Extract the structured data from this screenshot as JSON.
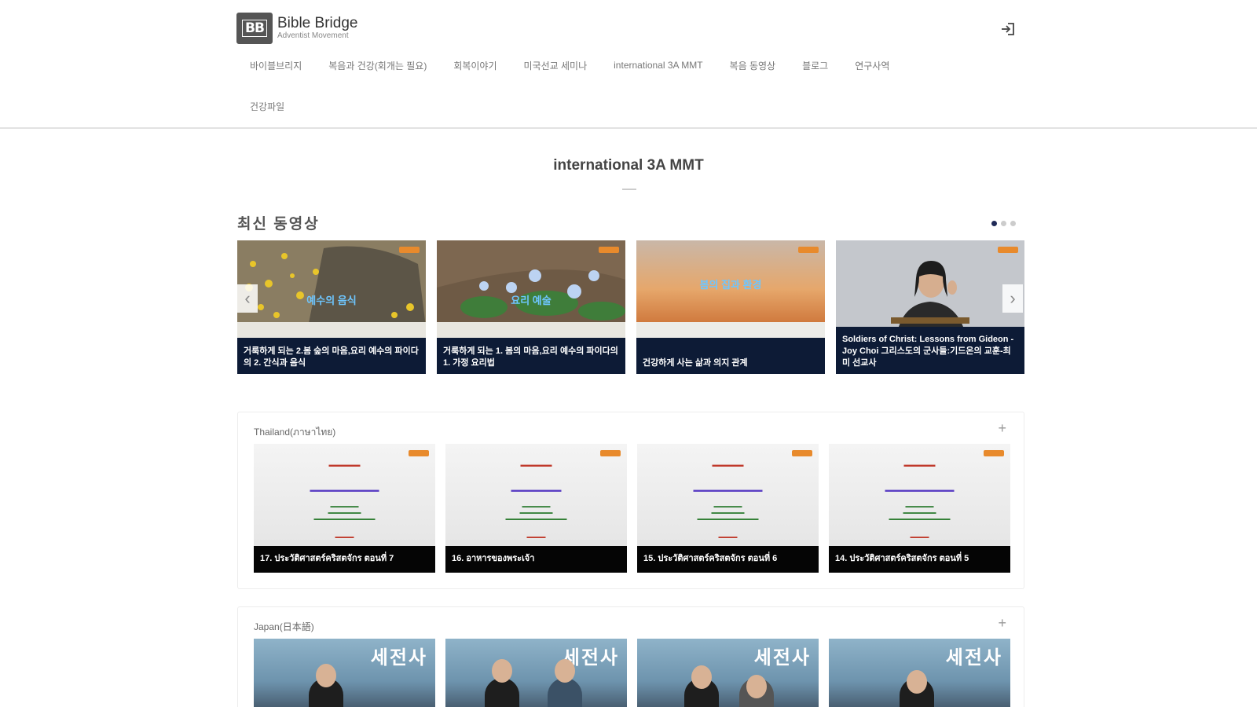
{
  "header": {
    "logo_mark": "BB",
    "logo_title": "Bible Bridge",
    "logo_sub": "Adventist Movement",
    "login_icon": "login-icon"
  },
  "nav": {
    "row1": [
      "바이블브리지",
      "복음과 건강(회개는 필요)",
      "회복이야기",
      "미국선교 세미나",
      "international 3A MMT",
      "복음 동영상",
      "블로그",
      "연구사역"
    ],
    "row2": [
      "건강파일"
    ]
  },
  "page_title": "international 3A MMT",
  "latest": {
    "heading": "최신 동영상",
    "cards": [
      {
        "overlay": "예수의 음식",
        "caption": "거룩하게 되는 2.봄 숲의 마음,요리 예수의 파이다의 2. 간식과 음식"
      },
      {
        "overlay": "요리 예술",
        "caption": "거룩하게 되는 1. 봄의 마음,요리 예수의 파이다의 1. 가정 요리법"
      },
      {
        "overlay": "봄의 집과 환경",
        "caption": "건강하게 사는 삶과 의지 관계"
      },
      {
        "overlay": "",
        "caption": "Soldiers of Christ: Lessons from Gideon - Joy Choi 그리스도의 군사들:기드온의 교훈-최미 선교사"
      }
    ]
  },
  "thailand": {
    "title": "Thailand(ภาษาไทย)",
    "plus": "+",
    "cards": [
      {
        "caption": "17. ประวัติศาสตร์คริสตจักร ตอนที่ 7"
      },
      {
        "caption": "16. อาหารของพระเจ้า"
      },
      {
        "caption": "15. ประวัติศาสตร์คริสตจักร ตอนที่ 6"
      },
      {
        "caption": "14. ประวัติศาสตร์คริสตจักร ตอนที่ 5"
      }
    ]
  },
  "japan": {
    "title": "Japan(日本語)",
    "plus": "+",
    "banner": "세전사"
  }
}
